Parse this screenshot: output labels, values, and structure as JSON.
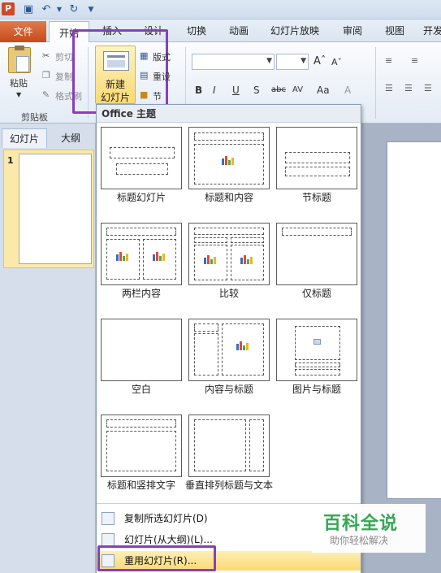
{
  "quick_access": {
    "icons": [
      "powerpoint-logo",
      "save-icon",
      "undo-icon",
      "redo-icon",
      "customize-icon"
    ],
    "app_letter": "P"
  },
  "tabs": [
    "文件",
    "开始",
    "插入",
    "设计",
    "切换",
    "动画",
    "幻灯片放映",
    "审阅",
    "视图",
    "开发"
  ],
  "ribbon": {
    "paste_label": "粘贴",
    "cut_label": "剪切",
    "copy_label": "复制",
    "format_painter_label": "格式刷",
    "clipboard_group": "剪贴板",
    "new_slide_line1": "新建",
    "new_slide_line2": "幻灯片",
    "layout_label": "版式",
    "reset_label": "重设",
    "section_label": "节",
    "font_buttons": [
      "B",
      "I",
      "U",
      "S",
      "abc",
      "AV",
      "Aa",
      "A"
    ]
  },
  "left_panel": {
    "tab_slides": "幻灯片",
    "tab_outline": "大纲",
    "slide_number": "1"
  },
  "gallery": {
    "header": "Office 主题",
    "layouts": [
      "标题幻灯片",
      "标题和内容",
      "节标题",
      "两栏内容",
      "比较",
      "仅标题",
      "空白",
      "内容与标题",
      "图片与标题",
      "标题和竖排文字",
      "垂直排列标题与文本"
    ]
  },
  "menu": {
    "duplicate": "复制所选幻灯片(D)",
    "from_outline": "幻灯片(从大纲)(L)...",
    "reuse": "重用幻灯片(R)..."
  },
  "watermark": {
    "title": "百科全说",
    "subtitle": "助你轻松解决"
  },
  "colors": {
    "file_tab": "#d2592a",
    "highlight_box": "#8a3fb8",
    "menu_hover": "#fbd875"
  }
}
